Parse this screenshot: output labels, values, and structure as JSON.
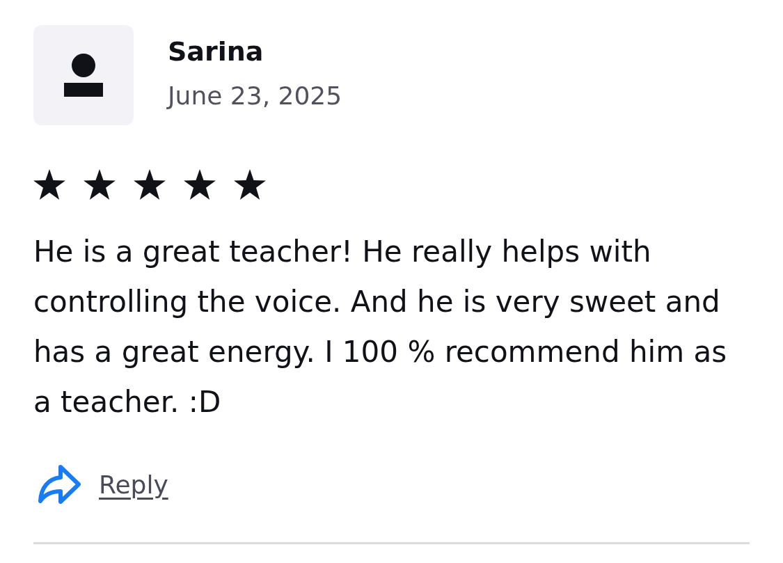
{
  "review": {
    "author": "Sarina",
    "date": "June 23, 2025",
    "stars": 5,
    "text": "He is a great teacher! He really helps with controlling the voice. And he is very sweet and has a great energy. I 100 % recommend him as a teacher. :D",
    "reply_label": "Reply"
  }
}
